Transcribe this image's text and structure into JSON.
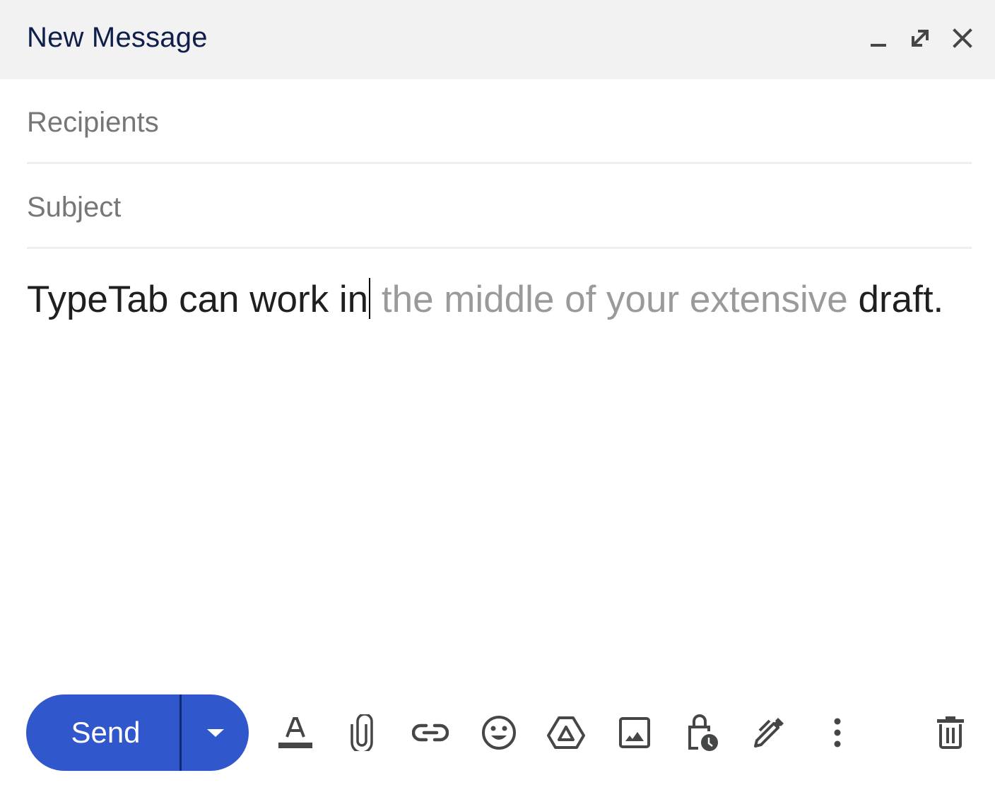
{
  "window": {
    "title": "New Message",
    "controls": {
      "minimize": "minimize-icon",
      "expand": "expand-icon",
      "close": "close-icon"
    }
  },
  "fields": {
    "recipients": {
      "value": "",
      "placeholder": "Recipients"
    },
    "subject": {
      "value": "",
      "placeholder": "Subject"
    }
  },
  "body": {
    "typed_before_cursor": "TypeTab can work in",
    "suggestion": " the middle of your extensive",
    "typed_after_suggestion": " draft."
  },
  "footer": {
    "send_label": "Send",
    "send_options_icon": "dropdown-arrow-icon",
    "tools": [
      {
        "name": "formatting-options",
        "icon": "text-format-icon"
      },
      {
        "name": "attach-files",
        "icon": "paperclip-icon"
      },
      {
        "name": "insert-link",
        "icon": "link-icon"
      },
      {
        "name": "insert-emoji",
        "icon": "emoji-icon"
      },
      {
        "name": "insert-drive-file",
        "icon": "drive-icon"
      },
      {
        "name": "insert-photo",
        "icon": "image-icon"
      },
      {
        "name": "confidential-mode",
        "icon": "lock-clock-icon"
      },
      {
        "name": "insert-signature",
        "icon": "pen-icon"
      },
      {
        "name": "more-options",
        "icon": "more-vert-icon"
      },
      {
        "name": "discard-draft",
        "icon": "trash-icon"
      }
    ]
  },
  "colors": {
    "send_button": "#3057cc",
    "title_text": "#0f1e4a",
    "suggestion_text": "#9a9a9a",
    "icon": "#444746"
  }
}
